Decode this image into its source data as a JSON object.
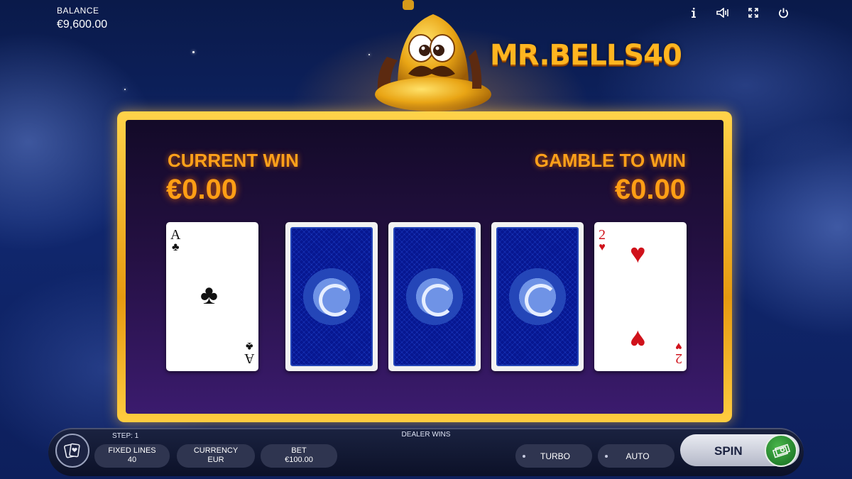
{
  "header": {
    "balance_label": "BALANCE",
    "balance_value": "€9,600.00",
    "icons": [
      "info-icon",
      "sound-icon",
      "fullscreen-icon",
      "power-icon"
    ],
    "logo": "MR.BELLS40"
  },
  "board": {
    "current_win_label": "CURRENT WIN",
    "current_win_value": "€0.00",
    "gamble_label": "GAMBLE TO WIN",
    "gamble_value": "€0.00",
    "cards": [
      {
        "state": "face",
        "rank": "A",
        "suit": "♣",
        "color": "#111111"
      },
      {
        "state": "back"
      },
      {
        "state": "back"
      },
      {
        "state": "back"
      },
      {
        "state": "face",
        "rank": "2",
        "suit": "♥",
        "color": "#d0121b"
      }
    ]
  },
  "footer": {
    "step": "STEP: 1",
    "message": "DEALER WINS",
    "fixed_lines_label": "FIXED LINES",
    "fixed_lines_value": "40",
    "currency_label": "CURRENCY",
    "currency_value": "EUR",
    "bet_label": "BET",
    "bet_value": "€100.00",
    "turbo": "TURBO",
    "auto": "AUTO",
    "spin": "SPIN"
  },
  "colors": {
    "accent": "#ff9e15",
    "frame": "#f2b628",
    "spin_green": "#2e8f35"
  }
}
